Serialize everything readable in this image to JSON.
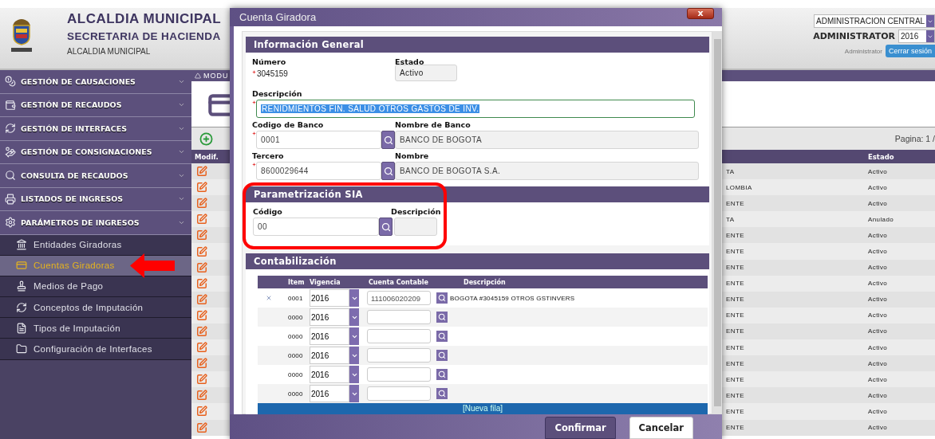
{
  "header": {
    "title": "ALCALDIA MUNICIPAL",
    "subtitle": "SECRETARIA DE HACIENDA",
    "caption": "ALCALDIA MUNICIPAL",
    "entity": "ADMINISTRACION CENTRAL",
    "user": "ADMINISTRATOR",
    "year": "2016",
    "role": "Administrator",
    "logout": "Cerrar sesión"
  },
  "sidebar": {
    "menus": [
      {
        "label": "GESTIÓN DE CAUSACIONES"
      },
      {
        "label": "GESTIÓN DE RECAUDOS"
      },
      {
        "label": "GESTIÓN DE INTERFACES"
      },
      {
        "label": "GESTIÓN DE CONSIGNACIONES"
      },
      {
        "label": "CONSULTA DE RECAUDOS"
      },
      {
        "label": "LISTADOS DE INGRESOS"
      },
      {
        "label": "PARÁMETROS DE INGRESOS",
        "children": [
          {
            "label": "Entidades Giradoras",
            "selected": false
          },
          {
            "label": "Cuentas Giradoras",
            "selected": true
          },
          {
            "label": "Medios de Pago",
            "selected": false
          },
          {
            "label": "Conceptos de Imputación",
            "selected": false
          },
          {
            "label": "Tipos de Imputación",
            "selected": false
          },
          {
            "label": "Configuración de Interfaces",
            "selected": false
          }
        ]
      }
    ]
  },
  "content": {
    "breadcrumb": "MODU",
    "page_info": "Pagina: 1 /",
    "columns": [
      "Modif.",
      "Estado"
    ],
    "rows": [
      {
        "column_2": "TA",
        "estado": "Activo"
      },
      {
        "column_2": "LOMBIA",
        "estado": "Activo"
      },
      {
        "column_2": "ENTE",
        "estado": "Activo"
      },
      {
        "column_2": "TA",
        "estado": "Anulado"
      },
      {
        "column_2": "ENTE",
        "estado": "Activo"
      },
      {
        "column_2": "ENTE",
        "estado": "Activo"
      },
      {
        "column_2": "ENTE",
        "estado": "Activo"
      },
      {
        "column_2": "ENTE",
        "estado": "Activo"
      },
      {
        "column_2": "ENTE",
        "estado": "Activo"
      },
      {
        "column_2": "ENTE",
        "estado": "Activo"
      },
      {
        "column_2": "ENTE",
        "estado": "Activo"
      },
      {
        "column_2": "ENTE",
        "estado": "Activo"
      },
      {
        "column_2": "ENTE",
        "estado": "Activo"
      },
      {
        "column_2": "ENTE",
        "estado": "Activo"
      },
      {
        "column_2": "ENTE",
        "estado": "Activo"
      },
      {
        "column_2": "ENTE",
        "estado": "Activo"
      },
      {
        "column_2": "ENTE",
        "estado": "Activo"
      }
    ]
  },
  "dialog": {
    "title": "Cuenta Giradora",
    "close": "x",
    "general": {
      "heading": "Información General",
      "numero": {
        "label": "Número",
        "value": "3045159",
        "required": true
      },
      "estado": {
        "label": "Estado",
        "value": "Activo"
      },
      "descripcion": {
        "label": "Descripción",
        "value": "RENIDMIENTOS FIN. SALUD OTROS GASTOS DE INV.",
        "required": true,
        "highlighted": true
      },
      "banco": {
        "label": "Codigo de Banco",
        "value": "0001",
        "required": true
      },
      "nombre_banco": {
        "label": "Nombre de Banco",
        "value": "BANCO DE BOGOTA"
      },
      "tercero": {
        "label": "Tercero",
        "value": "8600029644",
        "required": true
      },
      "nombre": {
        "label": "Nombre",
        "value": "BANCO DE BOGOTA S.A."
      }
    },
    "sia": {
      "heading": "Parametrización SIA",
      "codigo": {
        "label": "Código",
        "value": "00"
      },
      "descripcion": {
        "label": "Descripción"
      }
    },
    "accounting": {
      "heading": "Contabilización",
      "columns": [
        "Item",
        "Vigencia",
        "Cuenta Contable",
        "Descripción"
      ],
      "rows": [
        {
          "item": "0001",
          "vigencia": "2016",
          "cuenta": "111006020209",
          "descripcion": "BOGOTA #3045159 OTROS GSTINVERS",
          "deletable": true
        },
        {
          "item": "0000",
          "vigencia": "2016",
          "deletable": false
        },
        {
          "item": "0000",
          "vigencia": "2016",
          "deletable": false
        },
        {
          "item": "0000",
          "vigencia": "2016",
          "deletable": false
        },
        {
          "item": "0000",
          "vigencia": "2016",
          "deletable": false
        },
        {
          "item": "0000",
          "vigencia": "2016",
          "deletable": false
        }
      ],
      "add_row": "[Nueva fila]"
    },
    "buttons": [
      {
        "label": "Confirmar",
        "kind": "primary"
      },
      {
        "label": "Cancelar",
        "kind": "secondary"
      }
    ]
  }
}
